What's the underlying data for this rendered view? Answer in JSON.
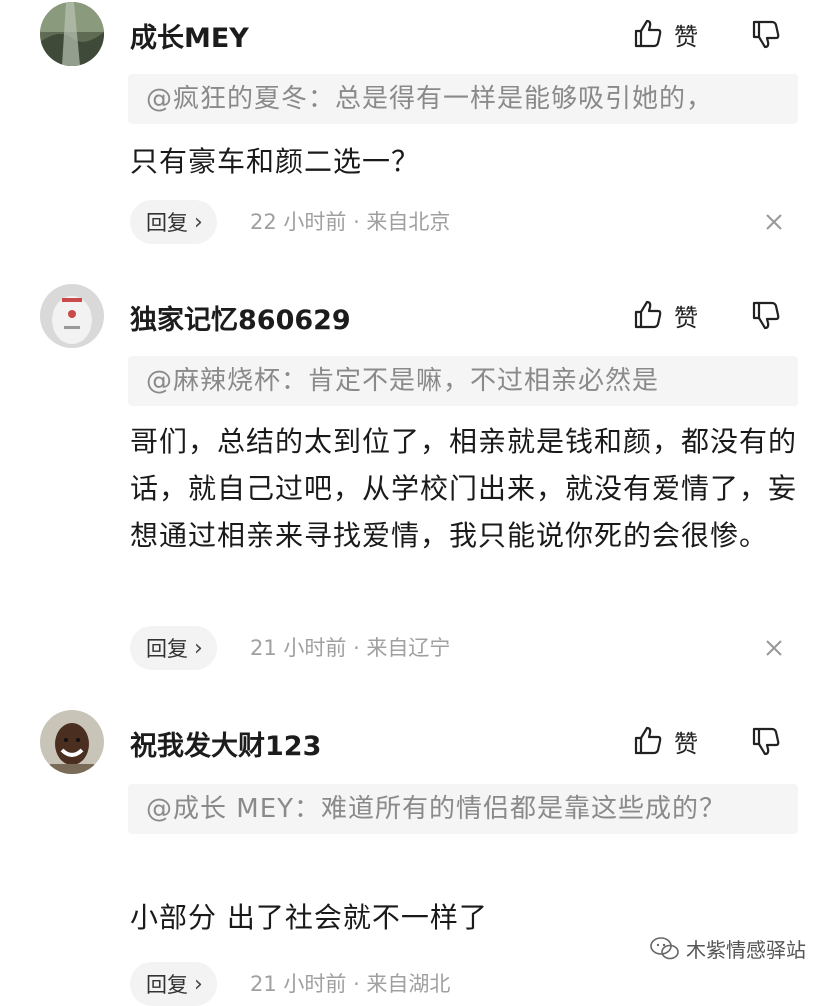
{
  "comments": [
    {
      "username": "成长MEY",
      "like_label": "赞",
      "quote": "@疯狂的夏冬：总是得有一样是能够吸引她的，",
      "body": "只有豪车和颜二选一？",
      "reply_label": "回复",
      "meta": "22 小时前 · 来自北京"
    },
    {
      "username": "独家记忆860629",
      "like_label": "赞",
      "quote": "@麻辣烧杯：肯定不是嘛，不过相亲必然是",
      "body": "哥们，总结的太到位了，相亲就是钱和颜，都没有的话，就自己过吧，从学校门出来，就没有爱情了，妄想通过相亲来寻找爱情，我只能说你死的会很惨。",
      "reply_label": "回复",
      "meta": "21 小时前 · 来自辽宁"
    },
    {
      "username": "祝我发大财123",
      "like_label": "赞",
      "quote": "@成长 MEY：难道所有的情侣都是靠这些成的？",
      "body": "小部分 出了社会就不一样了",
      "reply_label": "回复",
      "meta": "21 小时前 · 来自湖北"
    }
  ],
  "watermark": {
    "text": "木紫情感驿站"
  },
  "colors": {
    "quote_bg": "#f5f5f5",
    "meta_text": "#a0a0a0",
    "reply_bg": "#f3f3f3"
  }
}
